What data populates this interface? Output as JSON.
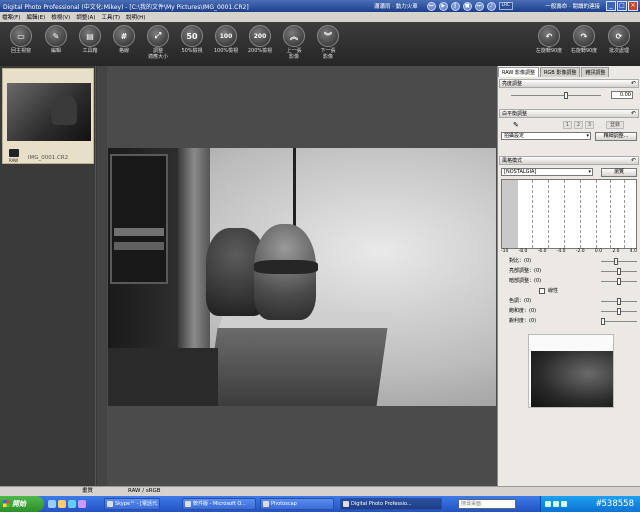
{
  "window": {
    "title": "Digital Photo Professional (中文化:Mikey) - [C:\\我的文件\\My Pictures\\IMG_0001.CR2]",
    "right_label": "一般壽命 · 閱讀的連接"
  },
  "media_bar": {
    "track": "瀟瀟雨 · 動力火車",
    "buttons": [
      "prev",
      "play",
      "pause",
      "stop",
      "next",
      "vol"
    ],
    "eq_label": "LRC"
  },
  "menu": [
    "檔案(F)",
    "編輯(E)",
    "檢視(V)",
    "調整(A)",
    "工具(T)",
    "說明(H)"
  ],
  "toolbar": {
    "buttons": [
      {
        "id": "main-window",
        "label": "回主視窗",
        "glyph": "▭"
      },
      {
        "id": "edit",
        "label": "編輯",
        "glyph": "✎"
      },
      {
        "id": "tool-palette",
        "label": "工具箱",
        "glyph": "▤"
      },
      {
        "id": "grid",
        "label": "格線",
        "glyph": "#"
      },
      {
        "id": "fit",
        "label": "調整\n適應大小",
        "glyph": "⤢"
      },
      {
        "id": "zoom-50",
        "label": "50%檢視",
        "glyph": "50"
      },
      {
        "id": "zoom-100",
        "label": "100%檢視",
        "glyph": "100"
      },
      {
        "id": "zoom-200",
        "label": "200%檢視",
        "glyph": "200"
      },
      {
        "id": "prev-image",
        "label": "上一張\n影像",
        "glyph": "︽"
      },
      {
        "id": "next-image",
        "label": "下一張\n影像",
        "glyph": "︾"
      }
    ],
    "right_buttons": [
      {
        "id": "rotate-left",
        "label": "左旋轉90度",
        "glyph": "↶"
      },
      {
        "id": "rotate-right",
        "label": "右旋轉90度",
        "glyph": "↷"
      },
      {
        "id": "batch",
        "label": "批次處理",
        "glyph": "⟳"
      }
    ]
  },
  "thumbnail": {
    "filename": "IMG_0001.CR2",
    "badge": "RAW"
  },
  "right_panel": {
    "tabs": [
      "RAW 影像調整",
      "RGB 影像調整",
      "雜訊調整"
    ],
    "brightness": {
      "header": "亮度調整",
      "value": "0.00"
    },
    "white_balance": {
      "header": "白平衡調整",
      "numbers": [
        "1",
        "2",
        "3"
      ],
      "reg_label": "登錄",
      "preset": "拍攝設定",
      "fine_tune": "精細調整..."
    },
    "picture_style": {
      "header": "風格模式",
      "value": "[NOSTALGIA]",
      "browse": "瀏覽",
      "axis": [
        "-10",
        "-8.0",
        "-6.0",
        "-4.0",
        "-2.0",
        "0.0",
        "2.0",
        "4.0"
      ],
      "sliders": [
        {
          "label": "對比：(0)",
          "level": 0.4
        },
        {
          "label": "亮部調整：(0)",
          "level": 0.5
        },
        {
          "label": "暗部調整：(0)",
          "level": 0.5
        }
      ],
      "linear_label": "線性",
      "sliders2": [
        {
          "label": "色調：(0)",
          "level": 0.5
        },
        {
          "label": "飽和度：(0)",
          "level": 0.5
        },
        {
          "label": "銳利度：(0)",
          "level": 0.0
        }
      ]
    }
  },
  "statusbar": {
    "item1": "畫質",
    "item2": "RAW / sRGB"
  },
  "taskbar": {
    "start": "開始",
    "tasks": [
      {
        "label": "Skype™ - [電話元...",
        "active": false
      },
      {
        "label": "軟件版 - Microsoft O...",
        "active": false
      },
      {
        "label": "Photoscap",
        "active": false
      },
      {
        "label": "Digital Photo Professio...",
        "active": true
      }
    ],
    "search_placeholder": "搜尋桌面",
    "clock": "#538558"
  }
}
